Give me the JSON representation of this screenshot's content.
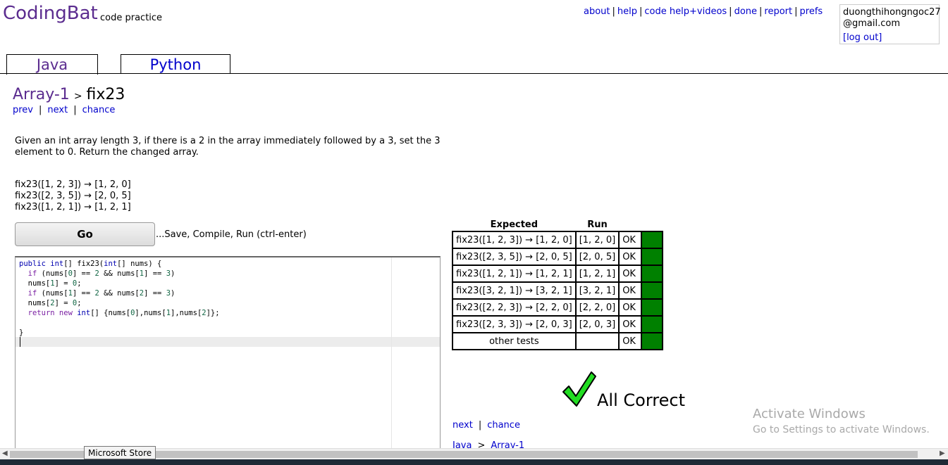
{
  "header": {
    "logo": "CodingBat",
    "logo_sub": "code practice",
    "nav": [
      "about",
      "help",
      "code help+videos",
      "done",
      "report",
      "prefs"
    ],
    "user_line1": "duongthihongngoc27",
    "user_line2": "@gmail.com",
    "logout": "[log out]"
  },
  "tabs": [
    {
      "label": "Java",
      "active": true
    },
    {
      "label": "Python",
      "active": false
    }
  ],
  "breadcrumb": {
    "section": "Array-1",
    "sep": ">",
    "problem": "fix23"
  },
  "problem_nav": [
    "prev",
    "next",
    "chance"
  ],
  "description": "Given an int array length 3, if there is a 2 in the array immediately followed by a 3, set the 3 element to 0. Return the changed array.",
  "examples": [
    "fix23([1, 2, 3]) → [1, 2, 0]",
    "fix23([2, 3, 5]) → [2, 0, 5]",
    "fix23([1, 2, 1]) → [1, 2, 1]"
  ],
  "go_button": "Go",
  "go_hint": "...Save, Compile, Run (ctrl-enter)",
  "results": {
    "headers": [
      "Expected",
      "Run"
    ],
    "rows": [
      {
        "expected": "fix23([1, 2, 3]) → [1, 2, 0]",
        "run": "[1, 2, 0]",
        "status": "OK"
      },
      {
        "expected": "fix23([2, 3, 5]) → [2, 0, 5]",
        "run": "[2, 0, 5]",
        "status": "OK"
      },
      {
        "expected": "fix23([1, 2, 1]) → [1, 2, 1]",
        "run": "[1, 2, 1]",
        "status": "OK"
      },
      {
        "expected": "fix23([3, 2, 1]) → [3, 2, 1]",
        "run": "[3, 2, 1]",
        "status": "OK"
      },
      {
        "expected": "fix23([2, 2, 3]) → [2, 2, 0]",
        "run": "[2, 2, 0]",
        "status": "OK"
      },
      {
        "expected": "fix23([2, 3, 3]) → [2, 0, 3]",
        "run": "[2, 0, 3]",
        "status": "OK"
      }
    ],
    "other_tests": {
      "label": "other tests",
      "run": "",
      "status": "OK"
    },
    "pass_color": "#008000"
  },
  "all_correct": "All Correct",
  "check_icon": "green-checkmark-icon",
  "bottom_nav": [
    "next",
    "chance"
  ],
  "bottom_crumb": {
    "lang": "Java",
    "sep": ">",
    "section": "Array-1"
  },
  "watermark": {
    "title": "Activate Windows",
    "sub": "Go to Settings to activate Windows."
  },
  "tooltip": "Microsoft Store"
}
